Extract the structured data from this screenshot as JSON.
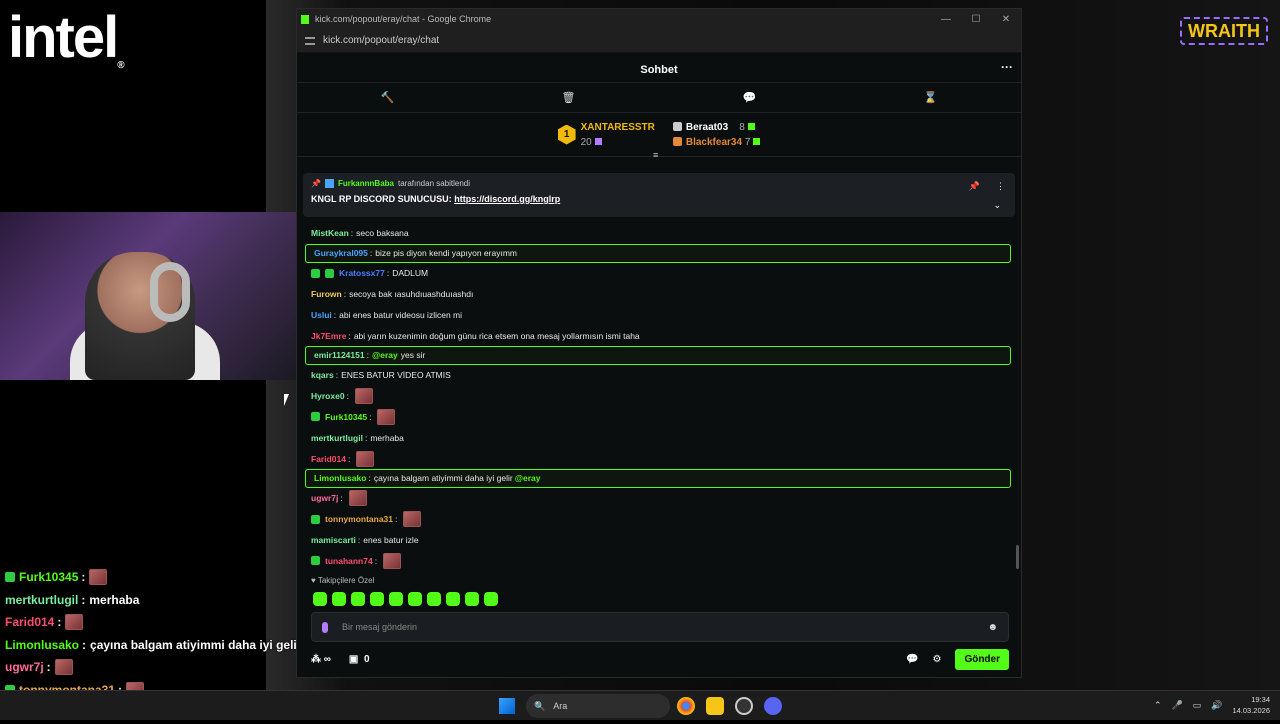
{
  "stream": {
    "brand_logo": "intel",
    "sponsor_logo": "WRAITH",
    "overlay_chat": [
      {
        "user": "Furk10345",
        "color": "#53fc18",
        "text": "",
        "emote": true,
        "badge": true
      },
      {
        "user": "mertkurtlugil",
        "color": "#7bed9f",
        "text": "merhaba",
        "emote": false,
        "badge": false
      },
      {
        "user": "Farid014",
        "color": "#ff4d6d",
        "text": "",
        "emote": true,
        "badge": false
      },
      {
        "user": "Limonlusako",
        "color": "#53fc18",
        "text": "çayına balgam atiyimmi daha iyi geli",
        "emote": false,
        "badge": false
      },
      {
        "user": "ugwr7j",
        "color": "#ff6b9a",
        "text": "",
        "emote": true,
        "badge": false
      },
      {
        "user": "tonnymontana31",
        "color": "#e8a84a",
        "text": "",
        "emote": true,
        "badge": true
      },
      {
        "user": "mamiscarti",
        "color": "#7bed9f",
        "text": "enes batur izle",
        "emote": false,
        "badge": false
      }
    ]
  },
  "browser": {
    "title": "kick.com/popout/eray/chat - Google Chrome",
    "url": "kick.com/popout/eray/chat"
  },
  "chat": {
    "header_title": "Sohbet",
    "leaderboard": {
      "first_name": "XANTARESSTR",
      "first_count": "20",
      "first_rank": "1",
      "second_name": "Beraat03",
      "second_count": "8",
      "third_name": "Blackfear34",
      "third_count": "7"
    },
    "pinned": {
      "pinned_by": "FurkannnBaba",
      "pinned_suffix": "tarafından sabitlendi",
      "message_prefix": "KNGL RP DISCORD SUNUCUSU:",
      "link": "https://discord.gg/knglrp"
    },
    "messages": [
      {
        "user": "MistKean",
        "color": "#7bed9f",
        "text": "seco baksana",
        "hl": false,
        "emote": false,
        "badges": 0,
        "mention": ""
      },
      {
        "user": "Guraykral095",
        "color": "#4aa3ff",
        "text": "bize pis diyon kendi yapıyon erayımm",
        "hl": true,
        "emote": false,
        "badges": 0,
        "mention": ""
      },
      {
        "user": "Kratossx77",
        "color": "#4a7dff",
        "text": "DADLUM",
        "hl": false,
        "emote": false,
        "badges": 2,
        "mention": ""
      },
      {
        "user": "Furown",
        "color": "#f0c85a",
        "text": "secoya bak ıasuhdıuashduıashdı",
        "hl": false,
        "emote": false,
        "badges": 0,
        "mention": ""
      },
      {
        "user": "Uslui",
        "color": "#4aa3ff",
        "text": "abi enes batur videosu izlicen mi",
        "hl": false,
        "emote": false,
        "badges": 0,
        "mention": ""
      },
      {
        "user": "Jk7Emre",
        "color": "#ff4d6d",
        "text": "abi yarın kuzenimin doğum günu rica etsem ona mesaj yollarmısın ismi taha",
        "hl": false,
        "emote": false,
        "badges": 0,
        "mention": ""
      },
      {
        "user": "emir1124151",
        "color": "#7bed9f",
        "text": "yes sir",
        "hl": true,
        "emote": false,
        "badges": 0,
        "mention": "@eray"
      },
      {
        "user": "kqars",
        "color": "#7bed9f",
        "text": "ENES BATUR VİDEO ATMIS",
        "hl": false,
        "emote": false,
        "badges": 0,
        "mention": ""
      },
      {
        "user": "Hyroxe0",
        "color": "#7bed9f",
        "text": "",
        "hl": false,
        "emote": true,
        "badges": 0,
        "mention": ""
      },
      {
        "user": "Furk10345",
        "color": "#53fc18",
        "text": "",
        "hl": false,
        "emote": true,
        "badges": 1,
        "mention": ""
      },
      {
        "user": "mertkurtlugil",
        "color": "#7bed9f",
        "text": "merhaba",
        "hl": false,
        "emote": false,
        "badges": 0,
        "mention": ""
      },
      {
        "user": "Farid014",
        "color": "#ff4d6d",
        "text": "",
        "hl": false,
        "emote": true,
        "badges": 0,
        "mention": ""
      },
      {
        "user": "Limonlusako",
        "color": "#53fc18",
        "text": "çayına balgam atiyimmi daha iyi gelir",
        "hl": true,
        "emote": false,
        "badges": 0,
        "mention": "@eray"
      },
      {
        "user": "ugwr7j",
        "color": "#ff6b9a",
        "text": "",
        "hl": false,
        "emote": true,
        "badges": 0,
        "mention": ""
      },
      {
        "user": "tonnymontana31",
        "color": "#e8a84a",
        "text": "",
        "hl": false,
        "emote": true,
        "badges": 1,
        "mention": ""
      },
      {
        "user": "mamiscarti",
        "color": "#7bed9f",
        "text": "enes batur izle",
        "hl": false,
        "emote": false,
        "badges": 0,
        "mention": ""
      },
      {
        "user": "tunahann74",
        "color": "#ff4d6d",
        "text": "",
        "hl": false,
        "emote": true,
        "badges": 1,
        "mention": ""
      }
    ],
    "followers_label": "Takipçilere Özel",
    "input_placeholder": "Bir mesaj gönderin",
    "infinite_label": "∞",
    "gift_count": "0",
    "send_label": "Gönder"
  },
  "taskbar": {
    "search_label": "Ara",
    "time": "19:34",
    "date": "14.03.2026"
  },
  "colors": {
    "accent": "#53fc18",
    "panel_bg": "#0b0e0f"
  }
}
